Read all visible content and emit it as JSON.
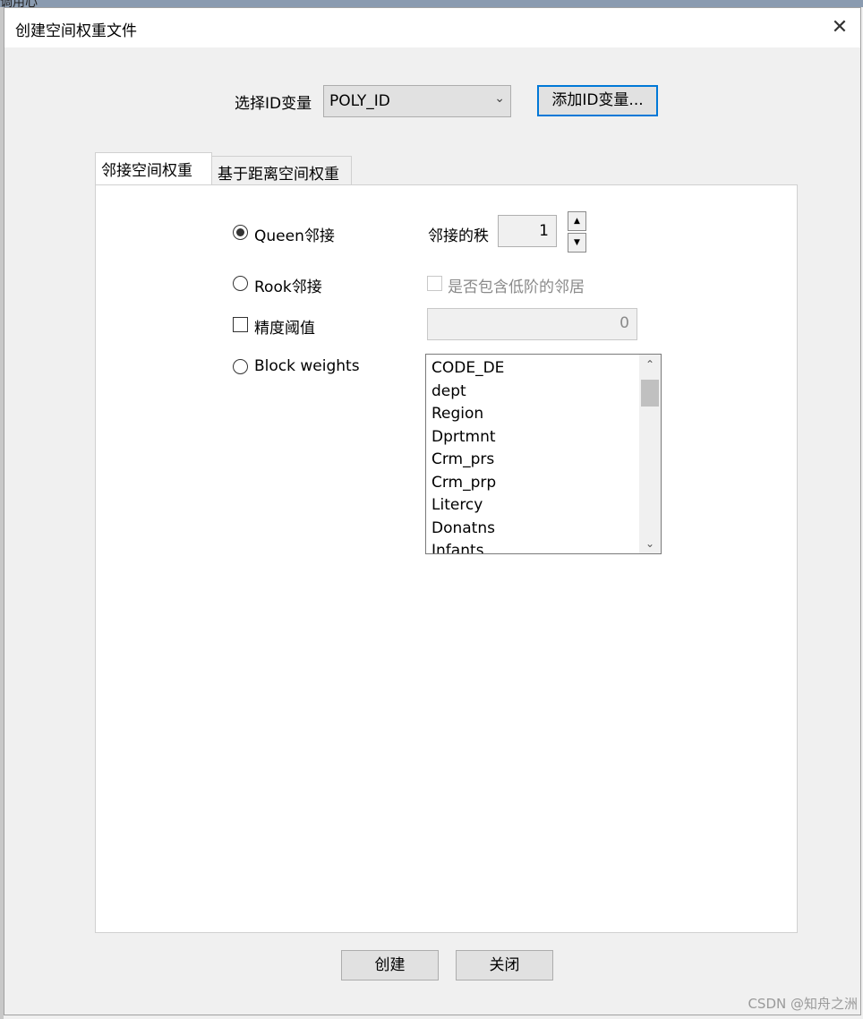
{
  "background": {
    "partial_text": "调用心"
  },
  "dialog": {
    "title": "创建空间权重文件",
    "close_label": "✕"
  },
  "id_select": {
    "label": "选择ID变量",
    "value": "POLY_ID",
    "add_button": "添加ID变量..."
  },
  "tabs": [
    {
      "label": "邻接空间权重",
      "active": true
    },
    {
      "label": "基于距离空间权重",
      "active": false
    }
  ],
  "contiguity": {
    "queen": {
      "label": "Queen邻接",
      "selected": true
    },
    "rook": {
      "label": "Rook邻接",
      "selected": false
    },
    "precision": {
      "label": "精度阈值",
      "checked": false,
      "value": "0"
    },
    "block": {
      "label": "Block weights",
      "selected": false
    },
    "order": {
      "label": "邻接的秩",
      "value": "1"
    },
    "lower_order": {
      "label": "是否包含低阶的邻居",
      "checked": false,
      "enabled": false
    },
    "variables": [
      "CODE_DE",
      "dept",
      "Region",
      "Dprtmnt",
      "Crm_prs",
      "Crm_prp",
      "Litercy",
      "Donatns",
      "Infants"
    ]
  },
  "footer": {
    "create": "创建",
    "close": "关闭"
  },
  "watermark": "CSDN @知舟之洲",
  "colors": {
    "focus_border": "#0078d7",
    "panel_bg": "#ffffff",
    "dialog_bg": "#f0f0f0"
  }
}
